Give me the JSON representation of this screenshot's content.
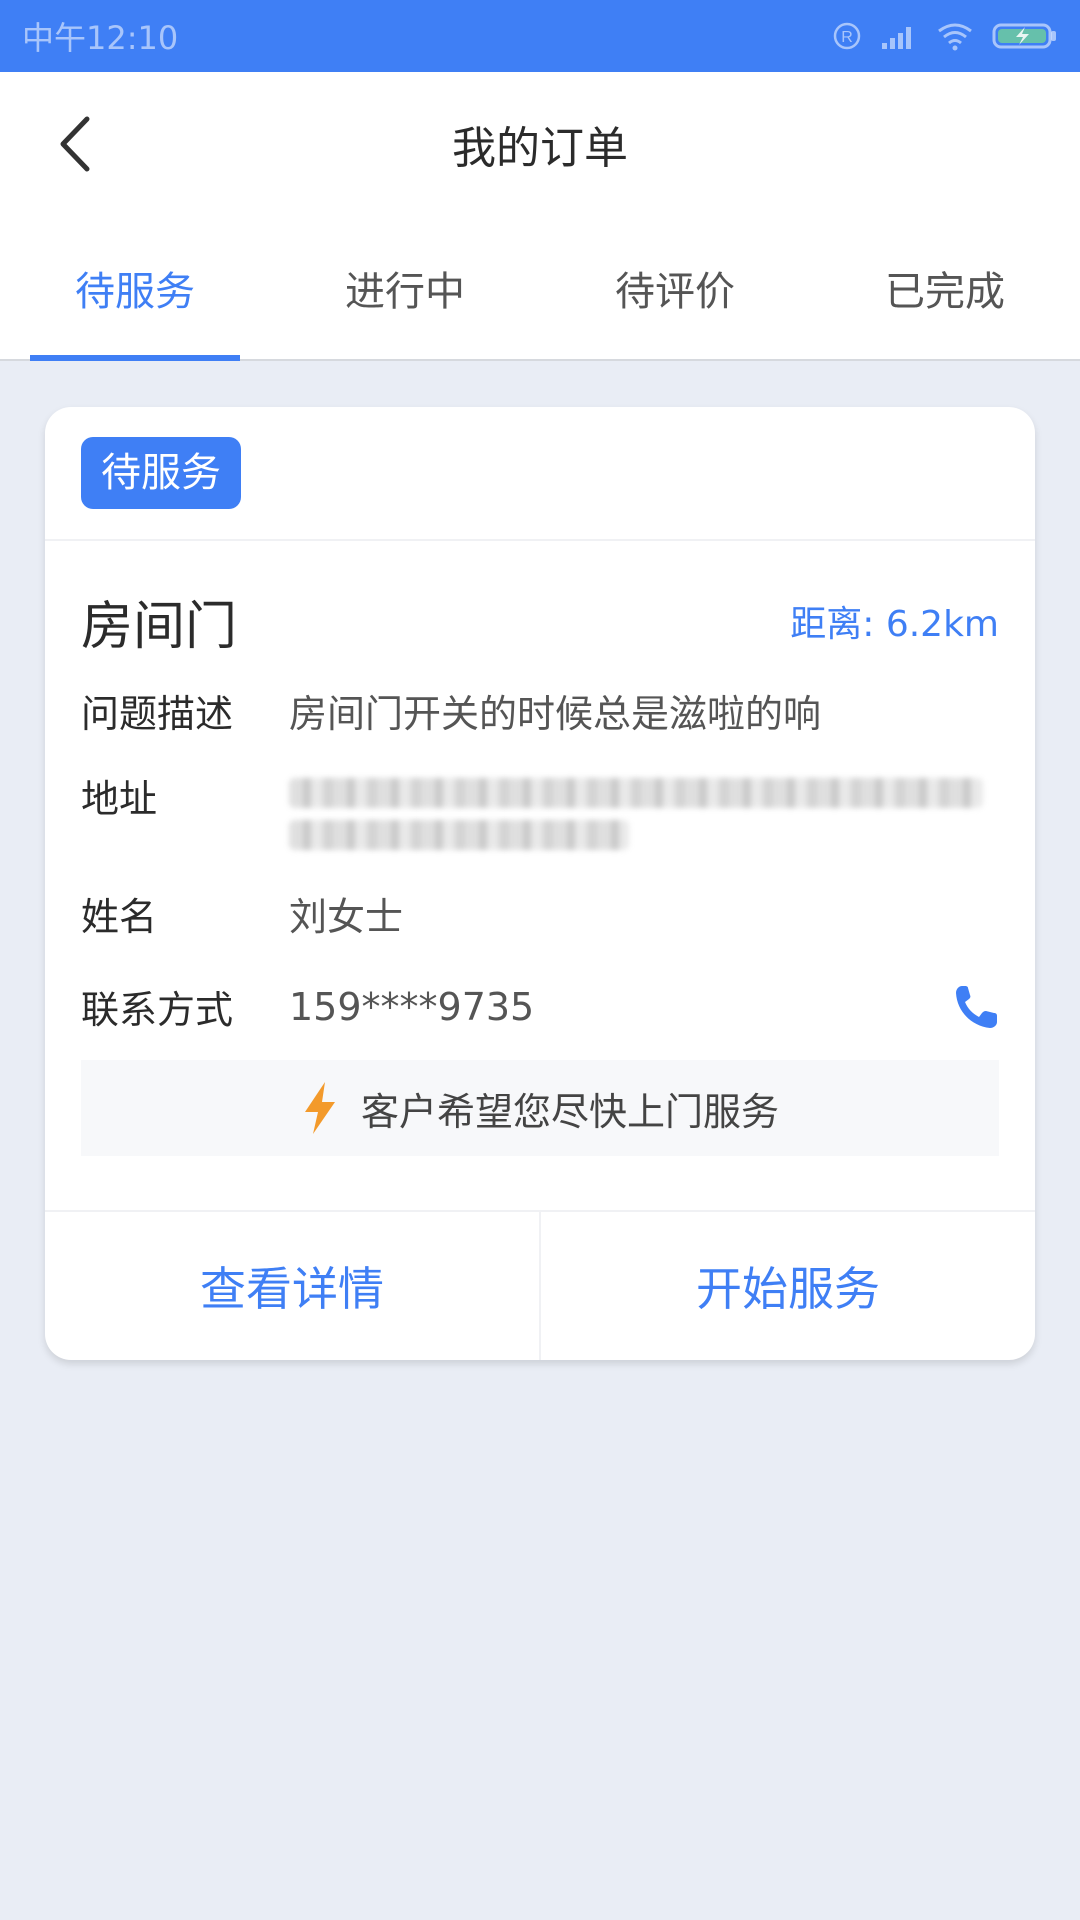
{
  "status_bar": {
    "time": "中午12:10"
  },
  "header": {
    "title": "我的订单",
    "back_icon": "chevron-left-icon"
  },
  "tabs": [
    {
      "label": "待服务",
      "active": true
    },
    {
      "label": "进行中",
      "active": false
    },
    {
      "label": "待评价",
      "active": false
    },
    {
      "label": "已完成",
      "active": false
    }
  ],
  "order": {
    "status": "待服务",
    "title": "房间门",
    "distance": "距离: 6.2km",
    "fields": {
      "problem_label": "问题描述",
      "problem_value": "房间门开关的时候总是滋啦的响",
      "address_label": "地址",
      "name_label": "姓名",
      "name_value": "刘女士",
      "contact_label": "联系方式",
      "contact_value": "159****9735"
    },
    "notice": "客户希望您尽快上门服务",
    "actions": {
      "details": "查看详情",
      "start": "开始服务"
    }
  },
  "colors": {
    "accent": "#3f7ff5",
    "bolt": "#f39a2b",
    "background": "#e9edf5"
  }
}
